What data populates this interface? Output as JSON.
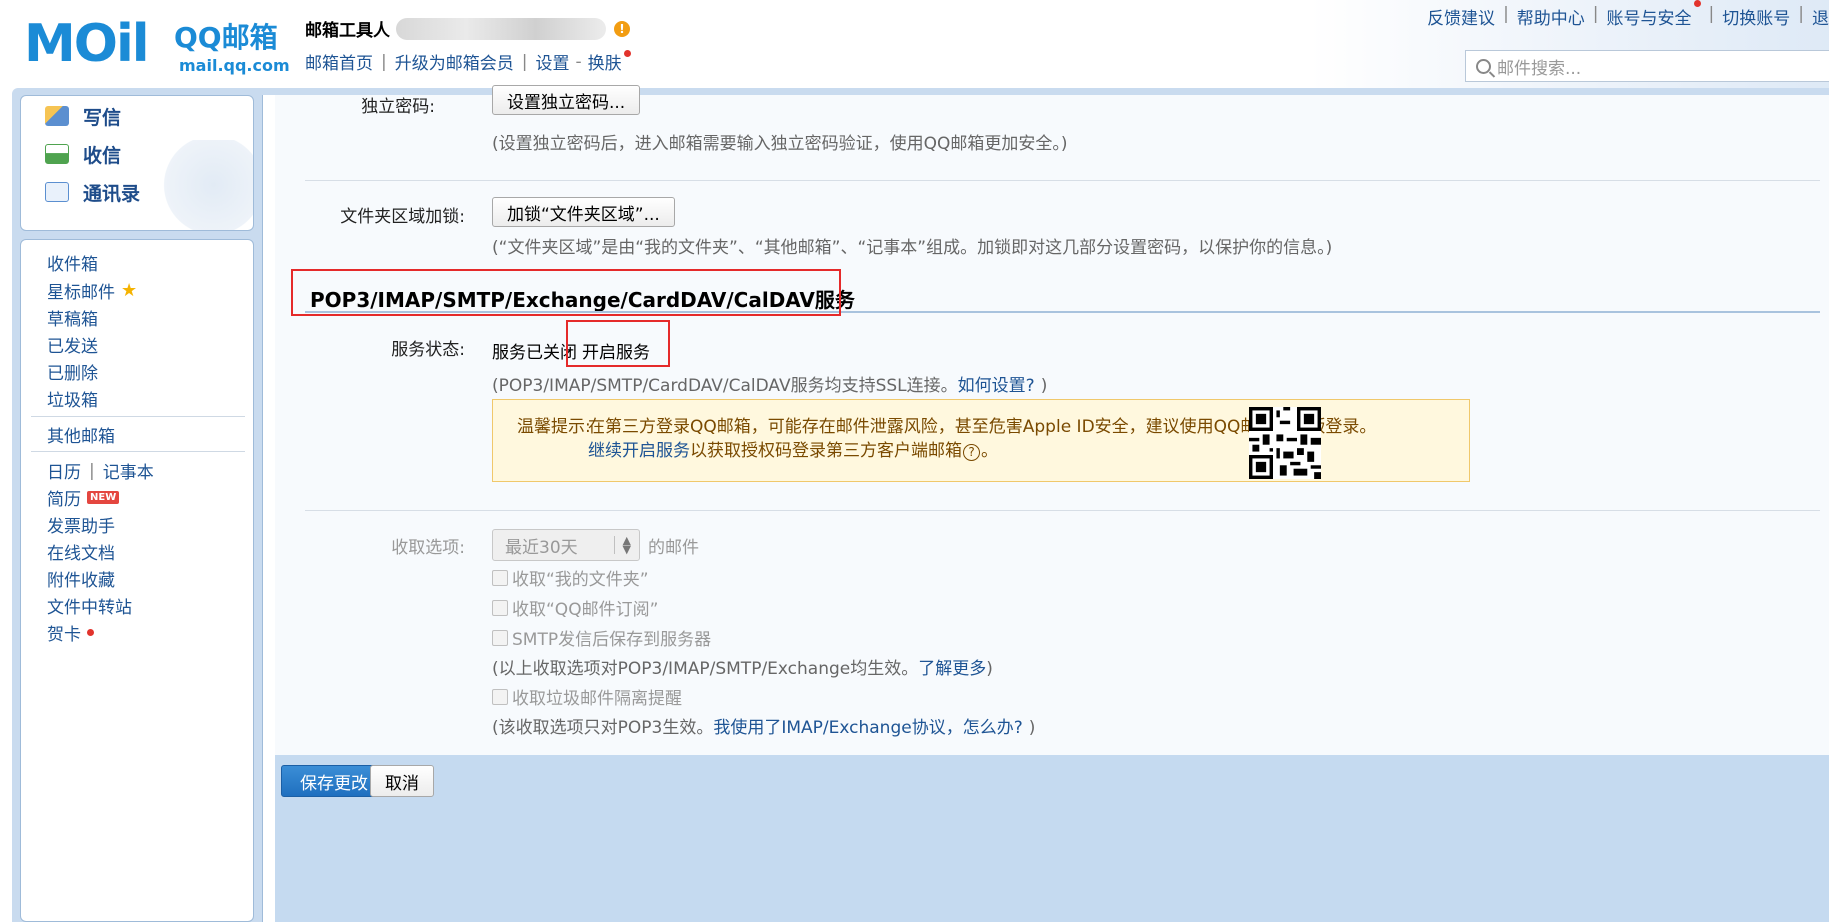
{
  "header": {
    "logo_text": "MOil",
    "logo_brand": "QQ邮箱",
    "logo_url": "mail.qq.com",
    "user_label": "邮箱工具人",
    "warn_glyph": "!",
    "user_links": [
      "邮箱首页",
      "升级为邮箱会员",
      "设置",
      "换肤"
    ],
    "settings_dash": "-",
    "top_links": [
      "反馈建议",
      "帮助中心",
      "账号与安全",
      "切换账号",
      "退"
    ],
    "search_placeholder": "邮件搜索..."
  },
  "sidebar": {
    "compose": [
      "写信",
      "收信",
      "通讯录"
    ],
    "folders": [
      "收件箱",
      "星标邮件",
      "草稿箱",
      "已发送",
      "已删除",
      "垃圾箱"
    ],
    "other_mail": "其他邮箱",
    "tools": [
      "日历",
      "记事本",
      "简历",
      "发票助手",
      "在线文档",
      "附件收藏",
      "文件中转站",
      "贺卡"
    ],
    "new_badge": "NEW"
  },
  "content": {
    "independent_password": {
      "label": "独立密码:",
      "button": "设置独立密码...",
      "note": "(设置独立密码后，进入邮箱需要输入独立密码验证，使用QQ邮箱更加安全。)"
    },
    "folder_lock": {
      "label": "文件夹区域加锁:",
      "button": "加锁“文件夹区域”...",
      "note": "(“文件夹区域”是由“我的文件夹”、“其他邮箱”、“记事本”组成。加锁即对这几部分设置密码，以保护你的信息。)"
    },
    "service_section": {
      "title": "POP3/IMAP/SMTP/Exchange/CardDAV/CalDAV服务",
      "status_label": "服务状态:",
      "status_text": "服务已关闭",
      "enable_link": "开启服务",
      "ssl_note_prefix": "(POP3/IMAP/SMTP/CardDAV/CalDAV服务均支持SSL连接。",
      "ssl_note_link": "如何设置?",
      "ssl_note_suffix": ")",
      "tip_label": "温馨提示:",
      "tip_line1": "在第三方登录QQ邮箱，可能存在邮件泄露风险，甚至危害Apple ID安全，建议使用QQ邮箱手机版登录。",
      "tip_line2_link": "继续开启服务",
      "tip_line2_text": "以获取授权码登录第三方客户端邮箱",
      "tip_help_icon": "?",
      "tip_line2_end": "。"
    },
    "fetch_options": {
      "label": "收取选项:",
      "select_value": "最近30天",
      "select_suffix": "的邮件",
      "checkbox_my_folder": "收取“我的文件夹”",
      "checkbox_subscription": "收取“QQ邮件订阅”",
      "checkbox_smtp_save": "SMTP发信后保存到服务器",
      "note1_prefix": "(以上收取选项对POP3/IMAP/SMTP/Exchange均生效。",
      "note1_link": "了解更多",
      "note1_suffix": ")",
      "checkbox_spam": "收取垃圾邮件隔离提醒",
      "note2_prefix": "(该收取选项只对POP3生效。",
      "note2_link": "我使用了IMAP/Exchange协议，怎么办?",
      "note2_suffix": ")"
    }
  },
  "actions": {
    "save": "保存更改",
    "cancel": "取消"
  }
}
